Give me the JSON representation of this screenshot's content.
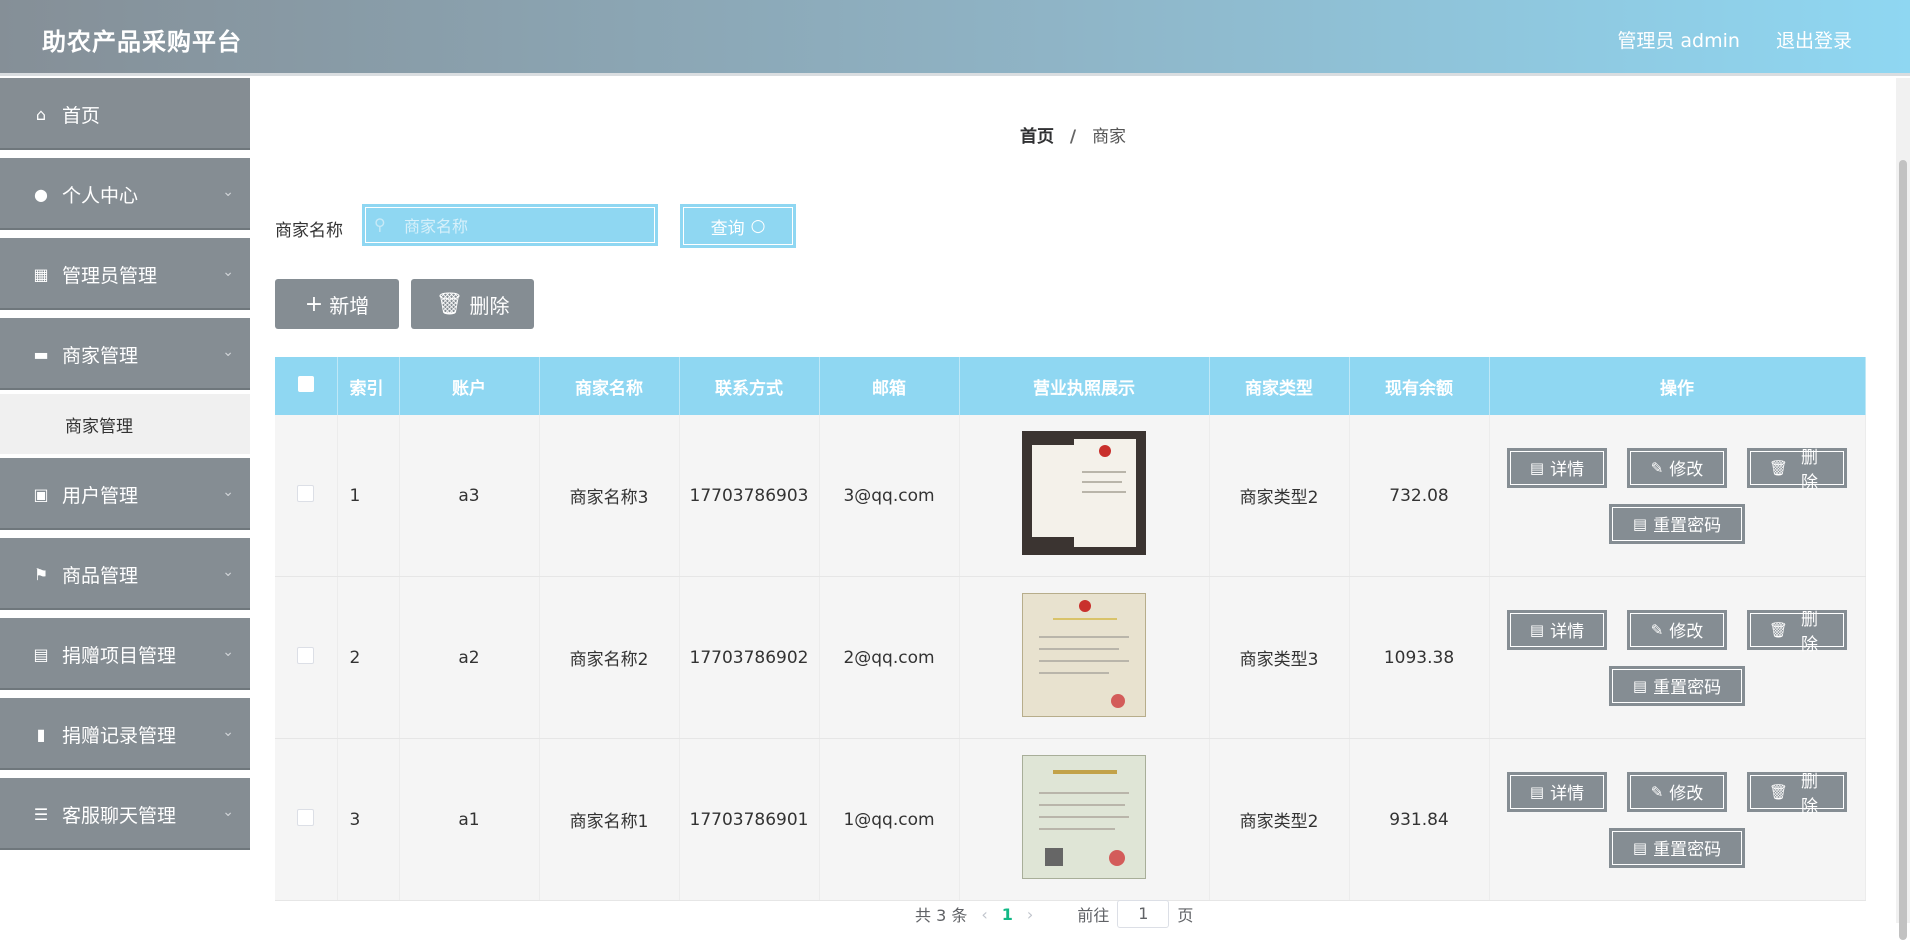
{
  "header": {
    "title": "助农产品采购平台",
    "user": "管理员 admin",
    "logout": "退出登录"
  },
  "sidebar": {
    "items": [
      {
        "label": "首页",
        "icon": "home-icon"
      },
      {
        "label": "个人中心",
        "icon": "user-icon"
      },
      {
        "label": "管理员管理",
        "icon": "grid-icon"
      },
      {
        "label": "商家管理",
        "icon": "shop-icon"
      },
      {
        "label": "用户管理",
        "icon": "briefcase-icon"
      },
      {
        "label": "商品管理",
        "icon": "flag-icon"
      },
      {
        "label": "捐赠项目管理",
        "icon": "apps-icon"
      },
      {
        "label": "捐赠记录管理",
        "icon": "clipboard-icon"
      },
      {
        "label": "客服聊天管理",
        "icon": "list-icon"
      }
    ],
    "submenu": {
      "label": "商家管理"
    }
  },
  "breadcrumb": {
    "home": "首页",
    "separator": "/",
    "current": "商家"
  },
  "search": {
    "label": "商家名称",
    "placeholder": "商家名称",
    "button": "查询"
  },
  "toolbar": {
    "add": "新增",
    "delete": "删除"
  },
  "table": {
    "headers": [
      "索引",
      "账户",
      "商家名称",
      "联系方式",
      "邮箱",
      "营业执照展示",
      "商家类型",
      "现有余额",
      "操作"
    ],
    "rows": [
      {
        "index": "1",
        "account": "a3",
        "name": "商家名称3",
        "phone": "17703786903",
        "email": "3@qq.com",
        "type": "商家类型2",
        "balance": "732.08"
      },
      {
        "index": "2",
        "account": "a2",
        "name": "商家名称2",
        "phone": "17703786902",
        "email": "2@qq.com",
        "type": "商家类型3",
        "balance": "1093.38"
      },
      {
        "index": "3",
        "account": "a1",
        "name": "商家名称1",
        "phone": "17703786901",
        "email": "1@qq.com",
        "type": "商家类型2",
        "balance": "931.84"
      }
    ],
    "ops": {
      "detail": "详情",
      "edit": "修改",
      "delete": "删除",
      "reset": "重置密码"
    }
  },
  "pagination": {
    "total": "共 3 条",
    "current": "1",
    "goto": "前往",
    "input": "1",
    "page": "页"
  },
  "colors": {
    "accent": "#8fd7f2",
    "sidebar": "#858d93"
  }
}
